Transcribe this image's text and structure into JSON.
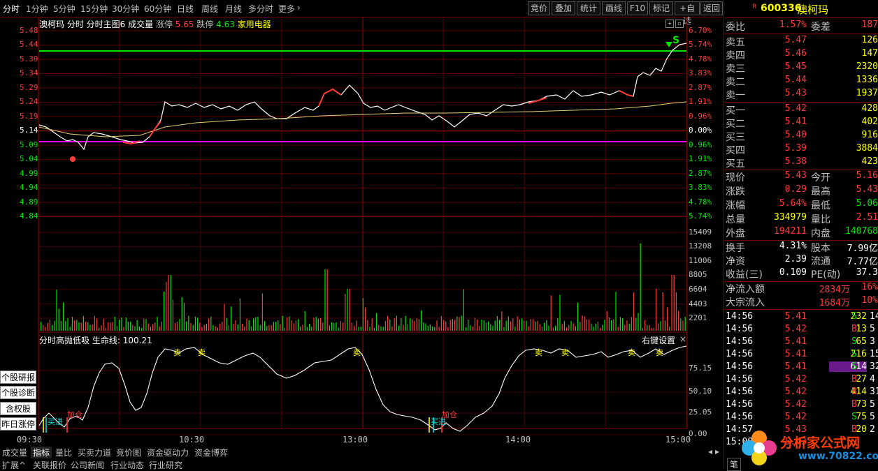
{
  "toolbar": {
    "tabs": [
      "分时",
      "1分钟",
      "5分钟",
      "15分钟",
      "30分钟",
      "60分钟",
      "日线",
      "周线",
      "月线",
      "多分时",
      "更多"
    ],
    "buttons": [
      "竞价",
      "叠加",
      "统计",
      "画线",
      "F10",
      "标记",
      "+自选",
      "返回"
    ]
  },
  "chart_info": {
    "name": "澳柯玛",
    "labels": "分时 分时主图6 成交量",
    "limit_up_label": "涨停",
    "limit_up": "5.65",
    "limit_down_label": "跌停",
    "limit_down": "4.63",
    "sector": "家用电器"
  },
  "price_axis_left": [
    "5.48",
    "5.44",
    "5.39",
    "5.34",
    "5.29",
    "5.24",
    "5.19",
    "5.14",
    "5.09",
    "5.04",
    "4.99",
    "4.94",
    "4.89",
    "4.84"
  ],
  "pct_axis_right": [
    "6.70%",
    "5.74%",
    "4.78%",
    "3.83%",
    "2.87%",
    "1.91%",
    "0.96%",
    "0.00%",
    "0.96%",
    "1.91%",
    "2.87%",
    "3.83%",
    "4.78%",
    "5.74%"
  ],
  "volume_axis": [
    "15409",
    "13208",
    "11006",
    "8805",
    "6604",
    "4403",
    "2201"
  ],
  "indicator": {
    "title": "分时高抛低吸",
    "lifeline_label": "生命线:",
    "lifeline": "100.21",
    "settings": "右键设置",
    "close": "×",
    "axis": [
      "75.15",
      "50.10",
      "25.05",
      "0.00"
    ],
    "tags": {
      "buy": "买进",
      "add": "加仓",
      "sell": "卖"
    }
  },
  "signal_s": "S",
  "side_buttons": [
    "个股研报",
    "个股诊断",
    "含权股",
    "昨日涨停"
  ],
  "x_axis": [
    "09:30",
    "10:30",
    "13:00",
    "14:00",
    "15:00"
  ],
  "bottom_tabs_row1": [
    "成交量",
    "指标",
    "量比",
    "买卖力道",
    "竞价图",
    "资金驱动力",
    "资金博弈"
  ],
  "bottom_tabs_row2": [
    "扩展^",
    "关联报价",
    "公司新闻",
    "行业动态",
    "行业研究"
  ],
  "panel": {
    "code": "600336",
    "name": "澳柯玛",
    "mark": "R",
    "weibi_label": "委比",
    "weibi": "1.57%",
    "weicha_label": "委差",
    "weicha": "187",
    "asks": [
      {
        "label": "卖五",
        "price": "5.47",
        "vol": "126"
      },
      {
        "label": "卖四",
        "price": "5.46",
        "vol": "147"
      },
      {
        "label": "卖三",
        "price": "5.45",
        "vol": "2320"
      },
      {
        "label": "卖二",
        "price": "5.44",
        "vol": "1336"
      },
      {
        "label": "卖一",
        "price": "5.43",
        "vol": "1937"
      }
    ],
    "bids": [
      {
        "label": "买一",
        "price": "5.42",
        "vol": "428"
      },
      {
        "label": "买二",
        "price": "5.41",
        "vol": "402"
      },
      {
        "label": "买三",
        "price": "5.40",
        "vol": "916"
      },
      {
        "label": "买四",
        "price": "5.39",
        "vol": "3884"
      },
      {
        "label": "买五",
        "price": "5.38",
        "vol": "423"
      }
    ],
    "stats": [
      {
        "l1": "现价",
        "v1": "5.43",
        "l2": "今开",
        "v2": "5.16"
      },
      {
        "l1": "涨跌",
        "v1": "0.29",
        "l2": "最高",
        "v2": "5.43"
      },
      {
        "l1": "涨幅",
        "v1": "5.64%",
        "l2": "最低",
        "v2": "5.06"
      },
      {
        "l1": "总量",
        "v1": "334979",
        "l2": "量比",
        "v2": "2.51"
      },
      {
        "l1": "外盘",
        "v1": "194211",
        "l2": "内盘",
        "v2": "140768"
      }
    ],
    "stats2": [
      {
        "l1": "换手",
        "v1": "4.31%",
        "l2": "股本",
        "v2": "7.99亿"
      },
      {
        "l1": "净资",
        "v1": "2.39",
        "l2": "流通",
        "v2": "7.77亿"
      },
      {
        "l1": "收益(三)",
        "v1": "0.109",
        "l2": "PE(动)",
        "v2": "37.3"
      }
    ],
    "flow": [
      {
        "label": "净流入额",
        "value": "2834万",
        "pct": "16%"
      },
      {
        "label": "大宗流入",
        "value": "1684万",
        "pct": "10%"
      }
    ],
    "ticks": [
      {
        "t": "14:56",
        "p": "5.41",
        "v": "232",
        "s": "S",
        "n": "14"
      },
      {
        "t": "14:56",
        "p": "5.42",
        "v": "13",
        "s": "B",
        "n": "5"
      },
      {
        "t": "14:56",
        "p": "5.41",
        "v": "65",
        "s": "S",
        "n": "3"
      },
      {
        "t": "14:56",
        "p": "5.41",
        "v": "216",
        "s": "S",
        "n": "15"
      },
      {
        "t": "14:56",
        "p": "5.41",
        "v": "614",
        "s": "S",
        "n": "32"
      },
      {
        "t": "14:56",
        "p": "5.42",
        "v": "27",
        "s": "B",
        "n": "4"
      },
      {
        "t": "14:56",
        "p": "5.42",
        "v": "414",
        "s": "B",
        "n": "31"
      },
      {
        "t": "14:56",
        "p": "5.42",
        "v": "73",
        "s": "B",
        "n": "5"
      },
      {
        "t": "14:56",
        "p": "5.42",
        "v": "75",
        "s": "S",
        "n": "5"
      },
      {
        "t": "14:57",
        "p": "5.43",
        "v": "20",
        "s": "B",
        "n": "2"
      },
      {
        "t": "15:00",
        "p": "5.43",
        "v": "",
        "s": "",
        "n": ""
      }
    ],
    "footer_tab": "笔"
  },
  "watermark": {
    "text": "分析家公式网",
    "url": "www.70822.com"
  },
  "colors": {
    "up": "#ff3c3c",
    "down": "#00e600",
    "grid": "#7a0000",
    "price_line": "#ffffff",
    "avg_line": "#e8d070",
    "limit_line": "#00e600",
    "ref_line": "#ff00ff"
  }
}
